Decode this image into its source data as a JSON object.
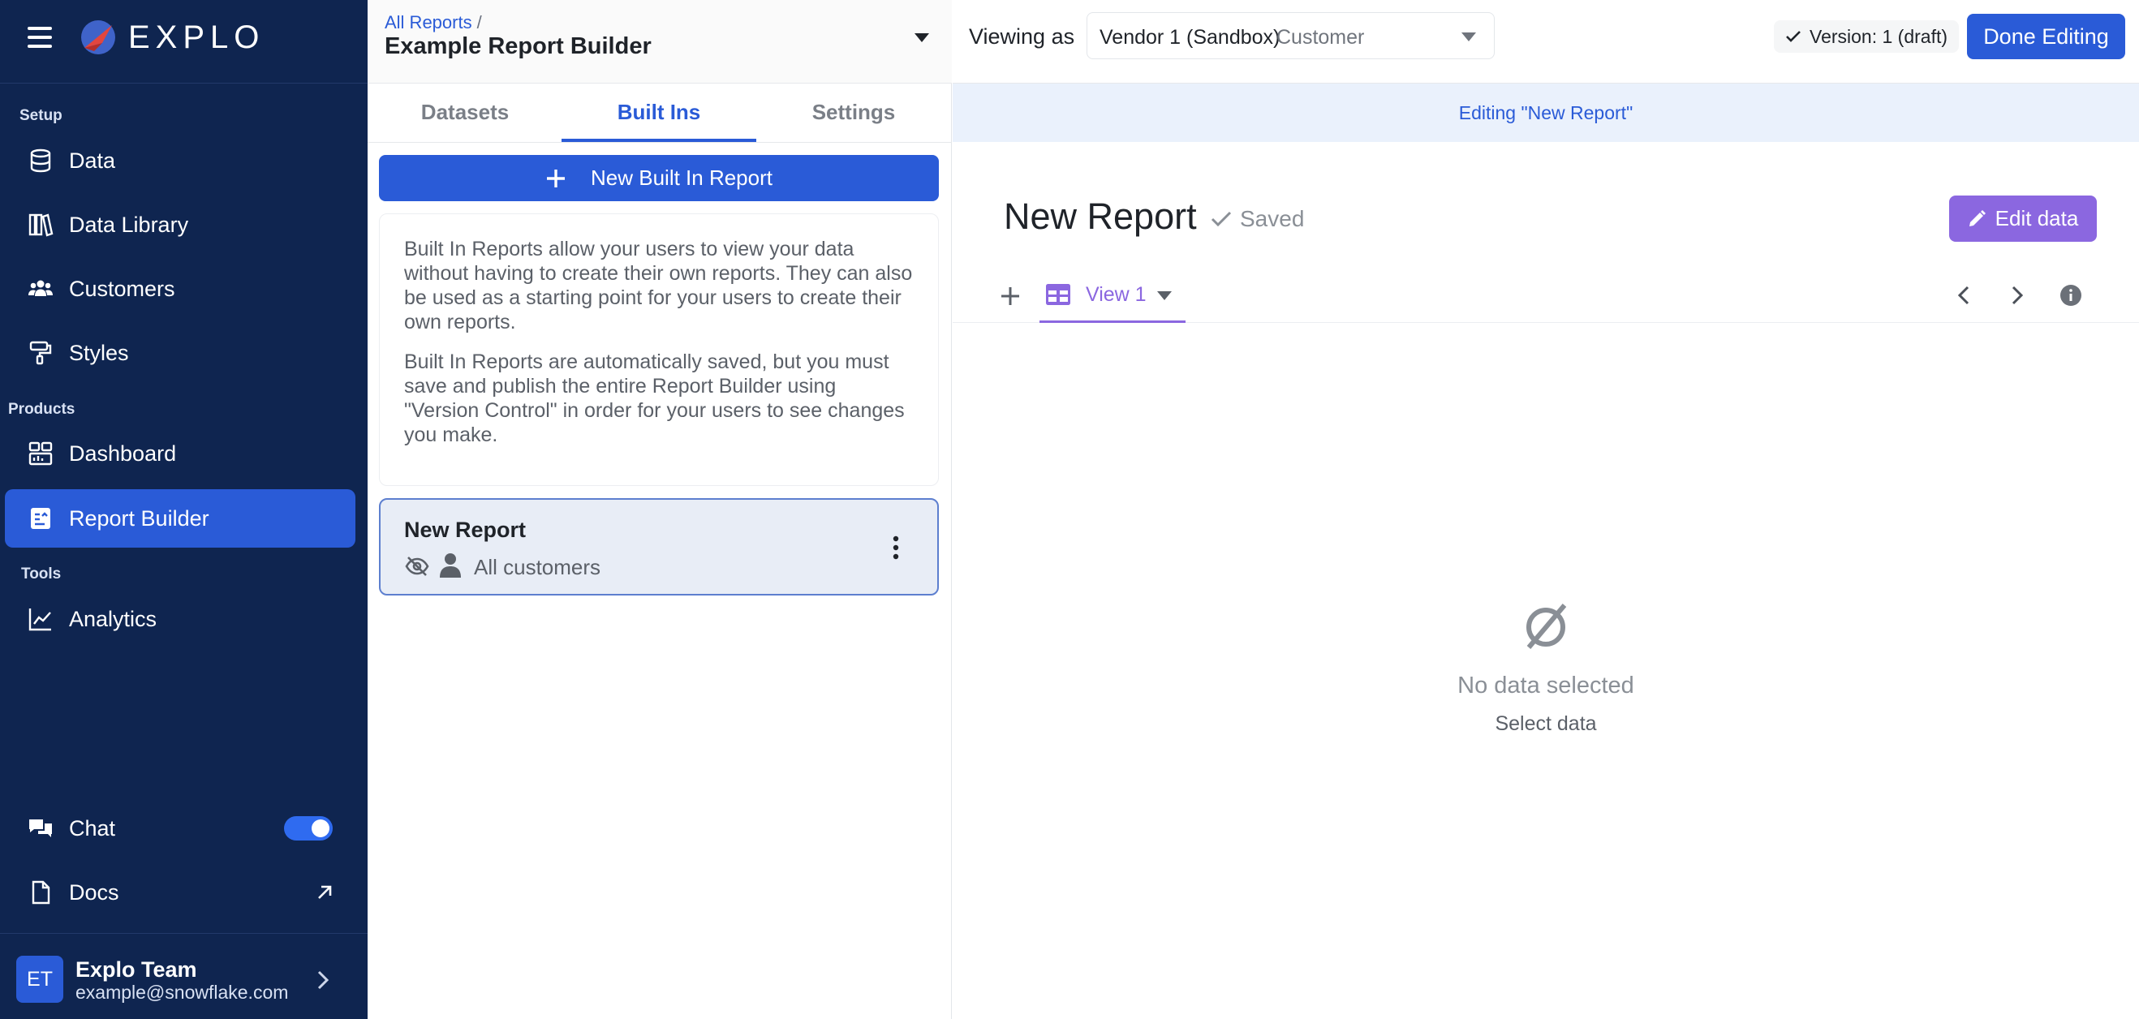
{
  "app": {
    "logo_text": "EXPLO"
  },
  "sidebar": {
    "sections": {
      "setup": "Setup",
      "products": "Products",
      "tools": "Tools"
    },
    "items": [
      {
        "label": "Data",
        "icon": "database-icon"
      },
      {
        "label": "Data Library",
        "icon": "library-icon"
      },
      {
        "label": "Customers",
        "icon": "users-icon"
      },
      {
        "label": "Styles",
        "icon": "paint-roller-icon"
      },
      {
        "label": "Dashboard",
        "icon": "dashboard-icon"
      },
      {
        "label": "Report Builder",
        "icon": "report-icon",
        "active": true
      },
      {
        "label": "Analytics",
        "icon": "line-chart-icon"
      },
      {
        "label": "Chat",
        "icon": "chat-icon",
        "toggle_on": true
      },
      {
        "label": "Docs",
        "icon": "document-icon"
      }
    ],
    "user": {
      "initials": "ET",
      "name": "Explo Team",
      "email": "example@snowflake.com"
    }
  },
  "builder": {
    "breadcrumb": "All Reports",
    "breadcrumb_sep": "/",
    "title": "Example Report Builder",
    "tabs": [
      "Datasets",
      "Built Ins",
      "Settings"
    ],
    "active_tab": "Built Ins",
    "new_button": "New Built In Report",
    "info_paragraphs": [
      "Built In Reports allow your users to view your data without having to create their own reports. They can also be used as a starting point for your users to create their own reports.",
      "Built In Reports are automatically saved, but you must save and publish the entire Report Builder using \"Version Control\" in order for your users to see changes you make."
    ],
    "report_card": {
      "title": "New Report",
      "audience": "All customers"
    }
  },
  "topbar": {
    "viewing_as": "Viewing as",
    "vendor_name": "Vendor 1 (Sandbox)",
    "vendor_kind": "Customer",
    "version": "Version: 1 (draft)",
    "done_button": "Done Editing"
  },
  "editor": {
    "banner": "Editing \"New Report\"",
    "report_title": "New Report",
    "saved_label": "Saved",
    "edit_data_button": "Edit data",
    "view_tab": "View 1",
    "empty_title": "No data selected",
    "empty_sub": "Select data"
  },
  "colors": {
    "sidebar_bg": "#0f2550",
    "accent_blue": "#2a5bd7",
    "accent_purple": "#8b67e0",
    "banner_bg": "#eaf1fc"
  }
}
